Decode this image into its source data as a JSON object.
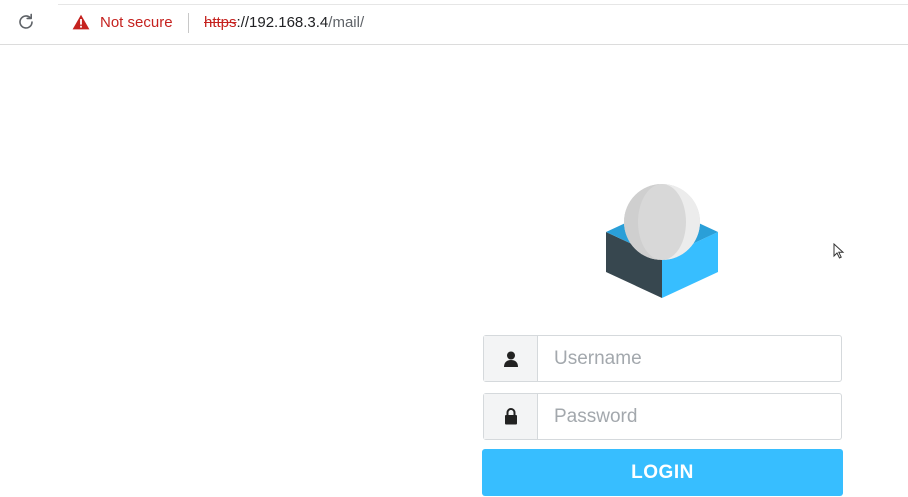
{
  "browser": {
    "security_label": "Not secure",
    "url_scheme": "https",
    "url_host": "://192.168.3.4",
    "url_path": "/mail/",
    "icons": {
      "reload": "reload-icon",
      "warning": "warning-triangle-icon"
    },
    "colors": {
      "warning": "#c5221f"
    }
  },
  "login": {
    "username_placeholder": "Username",
    "password_placeholder": "Password",
    "submit_label": "LOGIN",
    "icons": {
      "username": "user-icon",
      "password": "lock-icon"
    },
    "colors": {
      "button": "#37beff",
      "logo_blue": "#37beff",
      "logo_dark": "#37474f"
    }
  }
}
